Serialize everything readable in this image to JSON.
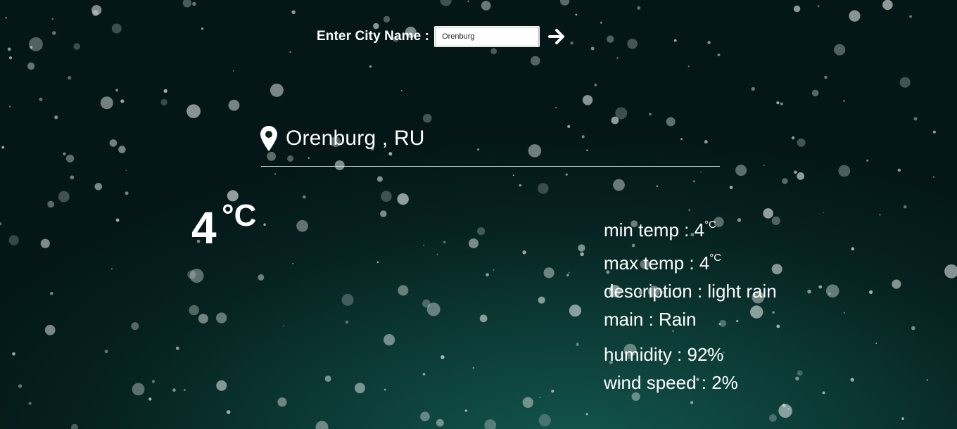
{
  "search": {
    "label": "Enter City Name :",
    "value": "Orenburg"
  },
  "icons": {
    "submit": "arrow-right-icon",
    "location": "map-pin-icon"
  },
  "location": {
    "text": "Orenburg , RU"
  },
  "current": {
    "temp": "4",
    "unit": "°C"
  },
  "details": {
    "min_temp_label": "min temp : 4",
    "min_temp_unit": "°C",
    "max_temp_label": "max temp : 4",
    "max_temp_unit": "°C",
    "description": "description : light rain",
    "main": "main : Rain",
    "humidity": "humidity : 92%",
    "wind_speed": "wind speed : 2%"
  },
  "colors": {
    "background_dark": "#041616",
    "background_teal": "#13574d",
    "text": "#ffffff",
    "bubble": "#cfd8d6"
  }
}
